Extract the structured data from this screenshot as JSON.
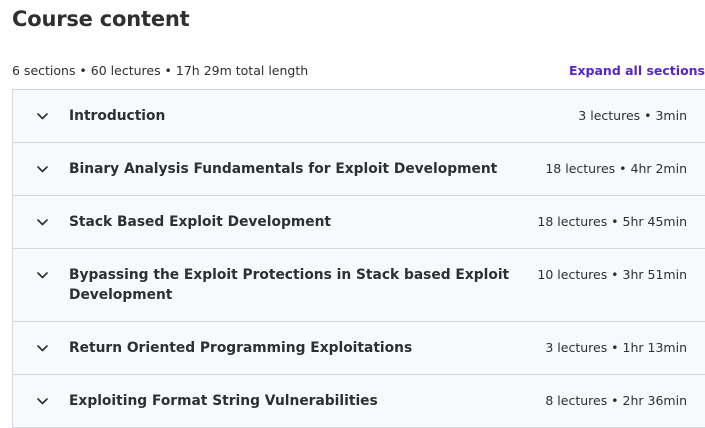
{
  "header": {
    "title": "Course content",
    "summary": "6 sections • 60 lectures • 17h 29m total length",
    "expand_label": "Expand all sections"
  },
  "icons": {
    "section_toggle": "chevron-down-icon"
  },
  "colors": {
    "accent": "#5624d0",
    "section_bg": "#f7f9fa",
    "border": "#d1d7dc",
    "text": "#2d2f31"
  },
  "sections": [
    {
      "title": "Introduction",
      "info": "3 lectures • 3min"
    },
    {
      "title": "Binary Analysis Fundamentals for Exploit Development",
      "info": "18 lectures • 4hr 2min"
    },
    {
      "title": "Stack Based Exploit Development",
      "info": "18 lectures • 5hr 45min"
    },
    {
      "title": "Bypassing the Exploit Protections in Stack based Exploit Development",
      "info": "10 lectures • 3hr 51min"
    },
    {
      "title": "Return Oriented Programming Exploitations",
      "info": "3 lectures • 1hr 13min"
    },
    {
      "title": "Exploiting Format String Vulnerabilities",
      "info": "8 lectures • 2hr 36min"
    }
  ]
}
